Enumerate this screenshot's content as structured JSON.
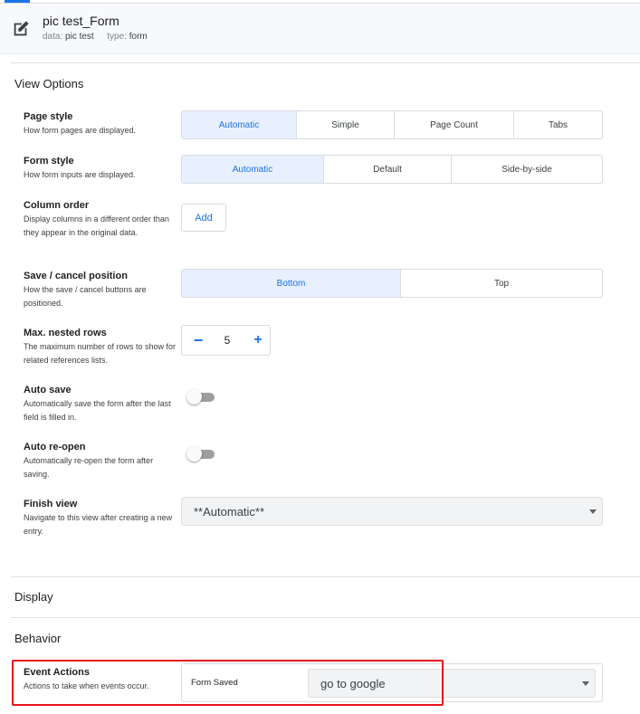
{
  "header": {
    "title": "pic test_Form",
    "data_label": "data:",
    "data_value": "pic test",
    "type_label": "type:",
    "type_value": "form"
  },
  "sections": {
    "view_options": "View Options",
    "display": "Display",
    "behavior": "Behavior"
  },
  "options": {
    "page_style": {
      "name": "Page style",
      "desc": "How form pages are displayed.",
      "choices": [
        "Automatic",
        "Simple",
        "Page Count",
        "Tabs"
      ],
      "selected": "Automatic"
    },
    "form_style": {
      "name": "Form style",
      "desc": "How form inputs are displayed.",
      "choices": [
        "Automatic",
        "Default",
        "Side-by-side"
      ],
      "selected": "Automatic"
    },
    "column_order": {
      "name": "Column order",
      "desc": "Display columns in a different order than they appear in the original data.",
      "button": "Add"
    },
    "save_cancel": {
      "name": "Save / cancel position",
      "desc": "How the save / cancel buttons are positioned.",
      "choices": [
        "Bottom",
        "Top"
      ],
      "selected": "Bottom"
    },
    "max_nested": {
      "name": "Max. nested rows",
      "desc": "The maximum number of rows to show for related references lists.",
      "value": "5",
      "minus": "−",
      "plus": "+"
    },
    "auto_save": {
      "name": "Auto save",
      "desc": "Automatically save the form after the last field is filled in.",
      "on": false
    },
    "auto_reopen": {
      "name": "Auto re-open",
      "desc": "Automatically re-open the form after saving.",
      "on": false
    },
    "finish_view": {
      "name": "Finish view",
      "desc": "Navigate to this view after creating a new entry.",
      "value": "**Automatic**"
    },
    "event_actions": {
      "name": "Event Actions",
      "desc": "Actions to take when events occur.",
      "event": "Form Saved",
      "action": "go to google"
    }
  },
  "icons": {
    "edit": "edit-icon",
    "caret": "caret-down-icon"
  },
  "colors": {
    "accent": "#1a73e8",
    "selected_bg": "#e8f0fe",
    "highlight": "#e8141c"
  }
}
